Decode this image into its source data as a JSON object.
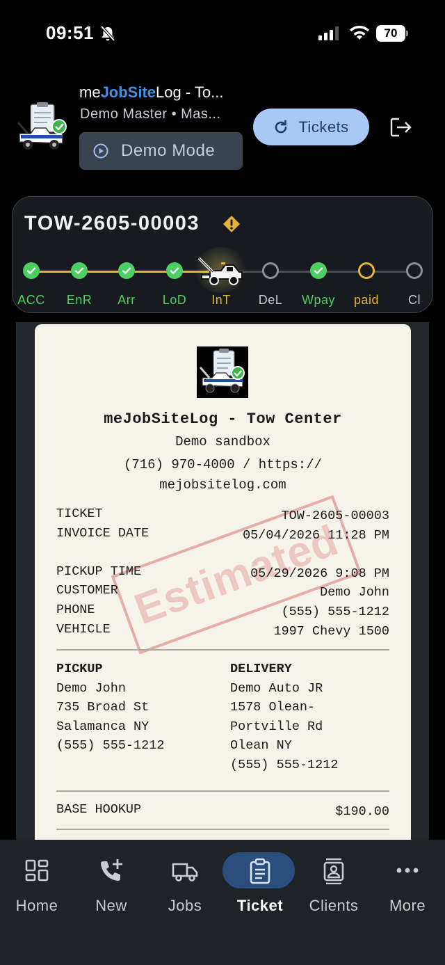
{
  "status_bar": {
    "time": "09:51",
    "battery": "70"
  },
  "header": {
    "title_prefix": "me",
    "title_accent": "JobSite",
    "title_suffix": "Log - To...",
    "subtitle": "Demo Master • Mas...",
    "demo_mode_label": "Demo Mode",
    "tickets_label": "Tickets"
  },
  "ticket": {
    "id": "TOW-2605-00003",
    "steps": [
      {
        "label": "ACC",
        "state": "done"
      },
      {
        "label": "EnR",
        "state": "done"
      },
      {
        "label": "Arr",
        "state": "done"
      },
      {
        "label": "LoD",
        "state": "done"
      },
      {
        "label": "InT",
        "state": "current"
      },
      {
        "label": "DeL",
        "state": "open"
      },
      {
        "label": "Wpay",
        "state": "done"
      },
      {
        "label": "paid",
        "state": "pending"
      },
      {
        "label": "Cl",
        "state": "open"
      }
    ],
    "colors": {
      "done": "#4ccf62",
      "current": "#e6b333",
      "open": "#8a8f98",
      "accent": "#4a90e2"
    }
  },
  "receipt": {
    "business": "meJobSiteLog - Tow Center",
    "sub": "Demo sandbox",
    "contact_line1": "(716) 970-4000 / https://",
    "contact_line2": "mejobsitelog.com",
    "fields": [
      {
        "key": "TICKET",
        "value": "TOW-2605-00003"
      },
      {
        "key": "INVOICE DATE",
        "value": "05/04/2026 11:28 PM"
      },
      {
        "key": "PICKUP TIME",
        "value": "05/29/2026 9:08 PM"
      },
      {
        "key": "CUSTOMER",
        "value": "Demo John"
      },
      {
        "key": "PHONE",
        "value": "(555) 555-1212"
      },
      {
        "key": "VEHICLE",
        "value": "1997 Chevy 1500"
      }
    ],
    "pickup": {
      "heading": "PICKUP",
      "name": "Demo John",
      "street": "735 Broad St",
      "city": "Salamanca NY",
      "phone": "(555) 555-1212"
    },
    "delivery": {
      "heading": "DELIVERY",
      "name": "Demo Auto JR",
      "street1": "1578 Olean-",
      "street2": "Portville Rd",
      "city": "Olean NY",
      "phone": "(555) 555-1212"
    },
    "line_items": [
      {
        "label": "BASE HOOKUP",
        "amount": "$190.00"
      }
    ],
    "stamp": "Estimated"
  },
  "nav": {
    "items": [
      {
        "label": "Home",
        "icon": "home-grid-icon"
      },
      {
        "label": "New",
        "icon": "phone-plus-icon"
      },
      {
        "label": "Jobs",
        "icon": "truck-icon"
      },
      {
        "label": "Ticket",
        "icon": "ticket-doc-icon",
        "active": true
      },
      {
        "label": "Clients",
        "icon": "contacts-icon"
      },
      {
        "label": "More",
        "icon": "more-dots-icon"
      }
    ]
  }
}
